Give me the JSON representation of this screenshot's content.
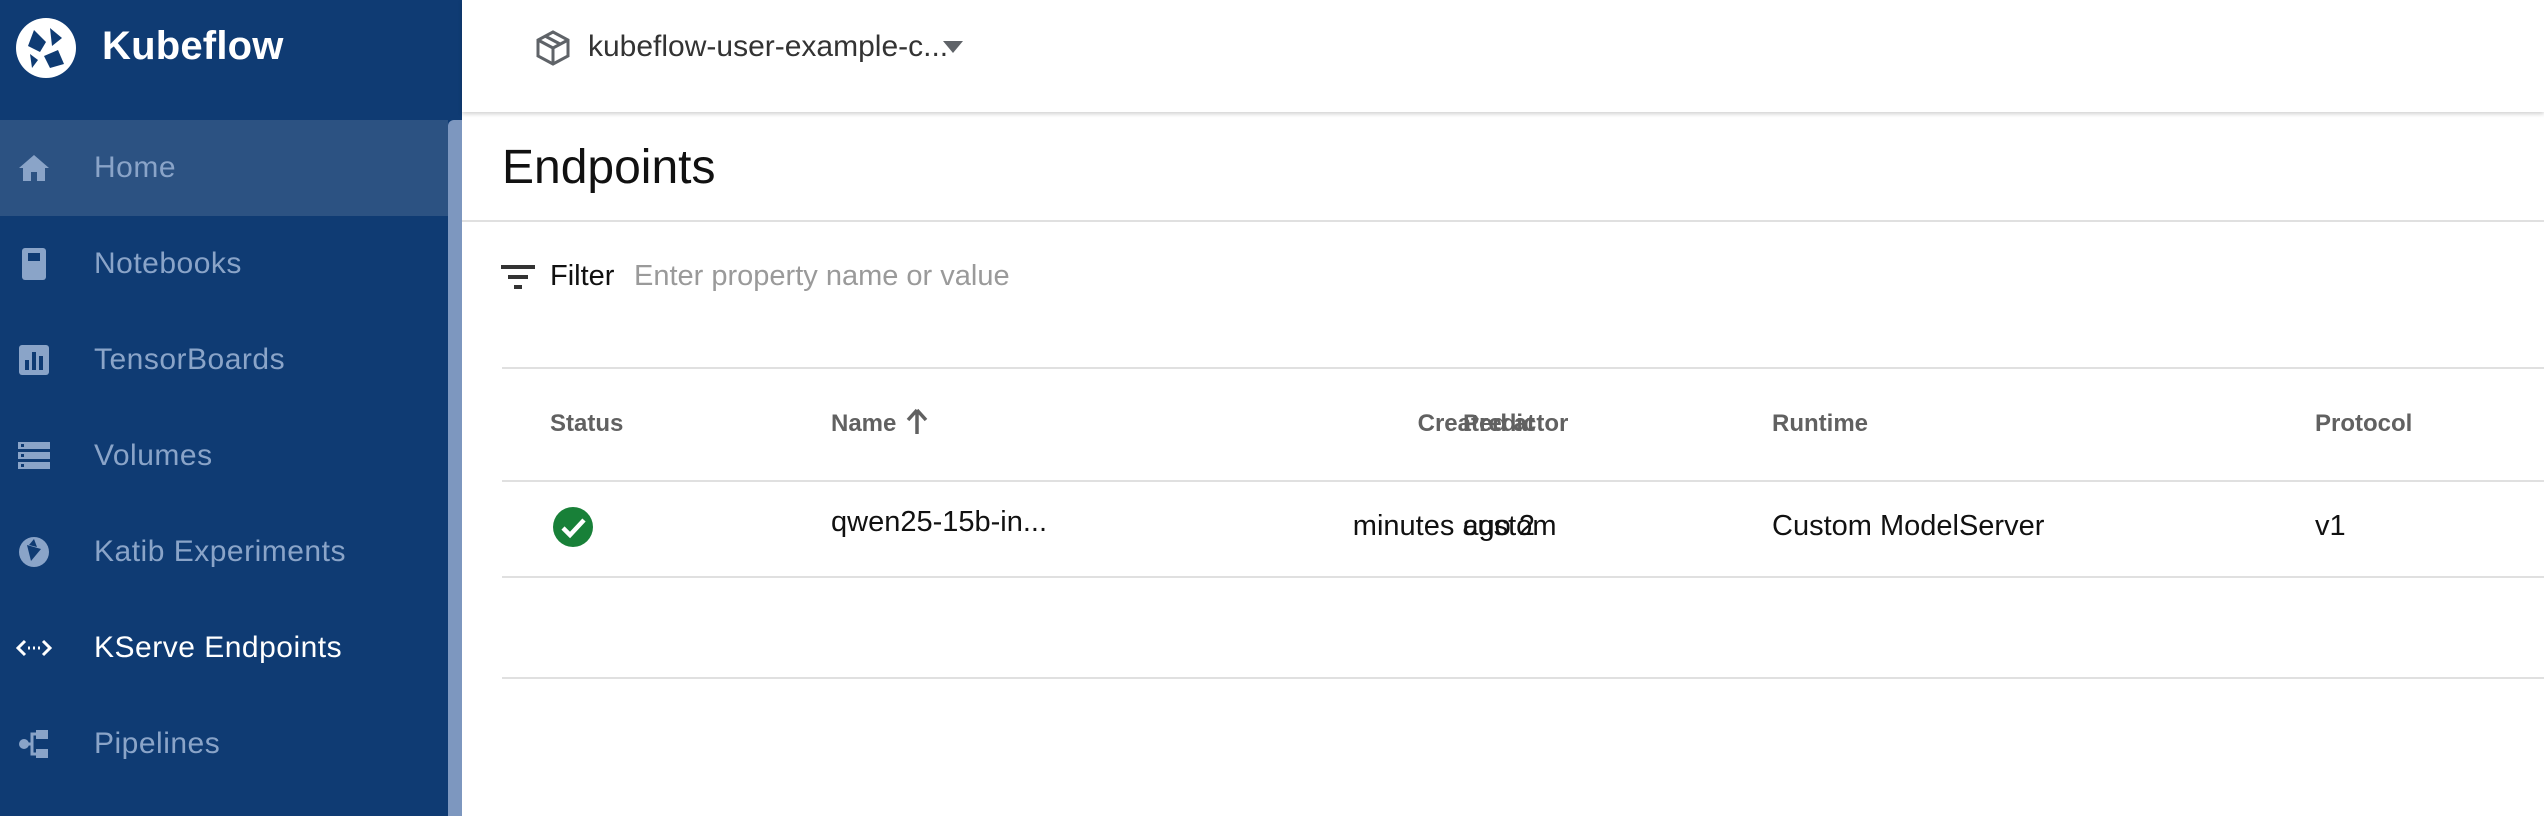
{
  "brand": {
    "name": "Kubeflow"
  },
  "namespace": {
    "value": "kubeflow-user-example-c..."
  },
  "sidebar": {
    "items": [
      {
        "label": "Home"
      },
      {
        "label": "Notebooks"
      },
      {
        "label": "TensorBoards"
      },
      {
        "label": "Volumes"
      },
      {
        "label": "Katib Experiments"
      },
      {
        "label": "KServe Endpoints"
      },
      {
        "label": "Pipelines"
      }
    ]
  },
  "page": {
    "title": "Endpoints"
  },
  "filter": {
    "label": "Filter",
    "placeholder": "Enter property name or value"
  },
  "table": {
    "headers": {
      "status": "Status",
      "name": "Name",
      "created_at": "Created at",
      "predictor": "Predictor",
      "runtime": "Runtime",
      "protocol": "Protocol"
    },
    "rows": [
      {
        "status": "ready",
        "name": "qwen25-15b-in...",
        "created_at": "2 minutes ago",
        "predictor": "custom",
        "runtime": "Custom ModelServer",
        "protocol": "v1"
      }
    ]
  },
  "colors": {
    "sidebar_bg": "#0f3b73",
    "sidebar_active": "#2c5282",
    "status_ok": "#188038"
  }
}
